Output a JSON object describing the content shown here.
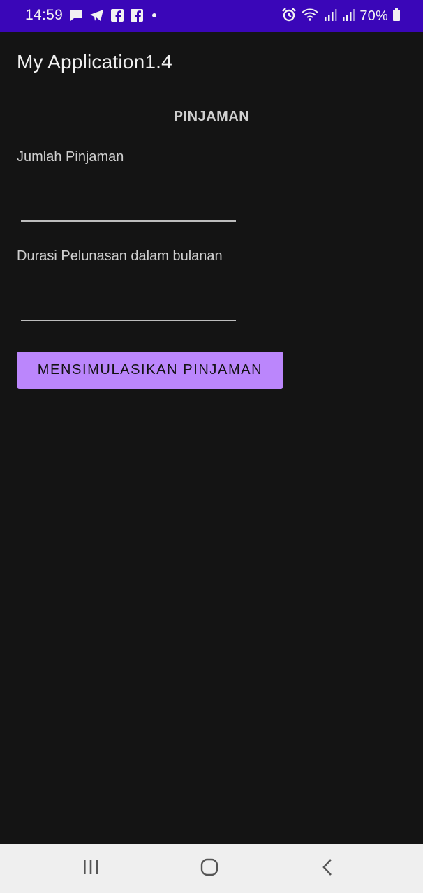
{
  "status_bar": {
    "time": "14:59",
    "battery_percent": "70%",
    "left_icons": [
      "chat-icon",
      "telegram-icon",
      "facebook-icon",
      "facebook-icon",
      "dot-icon"
    ],
    "right_icons": [
      "alarm-icon",
      "wifi-icon",
      "signal-icon",
      "signal-icon",
      "battery-icon"
    ]
  },
  "app_bar": {
    "title": "My Application1.4"
  },
  "main": {
    "heading": "PINJAMAN",
    "fields": [
      {
        "label": "Jumlah Pinjaman",
        "value": "",
        "placeholder": ""
      },
      {
        "label": "Durasi Pelunasan dalam bulanan",
        "value": "",
        "placeholder": ""
      }
    ],
    "button_label": "MENSIMULASIKAN PINJAMAN"
  },
  "nav_bar": {
    "icons": [
      "recents-icon",
      "home-icon",
      "back-icon"
    ]
  },
  "colors": {
    "status_bar": "#3a06b8",
    "background": "#141414",
    "accent_button": "#bb86fc",
    "nav_bar": "#efefef"
  }
}
